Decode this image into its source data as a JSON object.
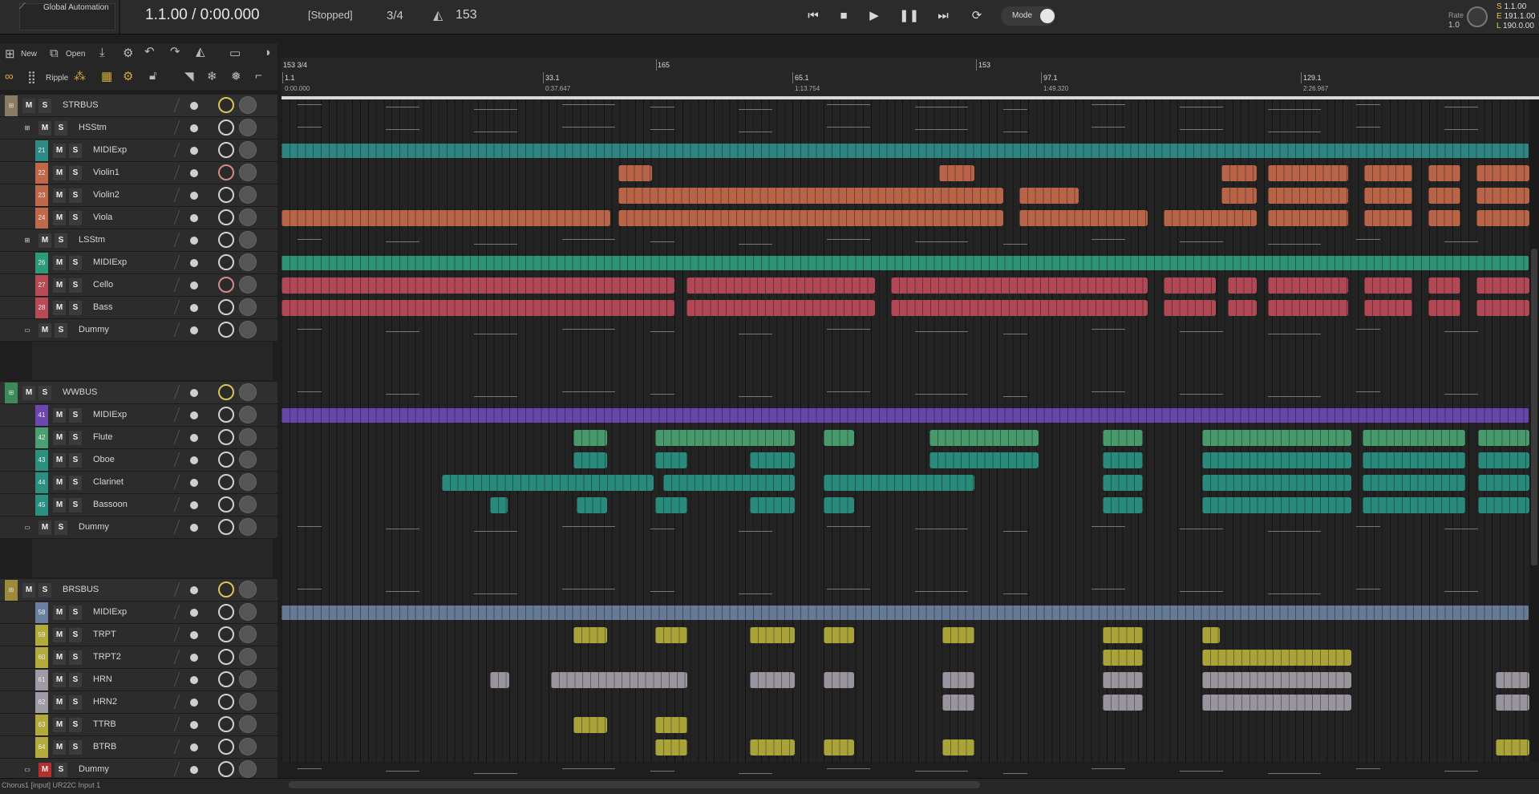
{
  "topbar": {
    "automation_label": "Global Automation",
    "position": "1.1.00 / 0:00.000",
    "state": "[Stopped]",
    "meter": "3/4",
    "tempo": "153",
    "mode_label": "Mode",
    "rate_label": "Rate",
    "rate_value": "1.0",
    "loop_start_label": "S",
    "loop_start": "1.1.00",
    "loop_end_label": "E",
    "loop_end": "191.1.00",
    "loop_length_label": "L",
    "loop_length": "190.0.00"
  },
  "toolbar": {
    "new_label": "New",
    "open_label": "Open",
    "ripple_label": "Ripple"
  },
  "ruler": {
    "marker_label": "153 3/4",
    "markers": [
      {
        "bar": "1.1",
        "time": "0:00.000"
      },
      {
        "bar": "33.1",
        "time": "0:37.647"
      },
      {
        "bar": "65.1",
        "time": "1:13.754"
      },
      {
        "bar": "97.1",
        "time": "1:49.320"
      },
      {
        "bar": "129.1",
        "time": "2:26.967"
      }
    ],
    "tempo_marks": [
      "165",
      "153"
    ]
  },
  "tracks": [
    {
      "id": "strbus",
      "num": "",
      "name": "STRBUS",
      "type": "bus",
      "color": "#8a7a64"
    },
    {
      "id": "hsstm",
      "num": "",
      "name": "HSStm",
      "type": "stem",
      "color": "#2c2c2c"
    },
    {
      "id": "t21",
      "num": "21",
      "name": "MIDIExp",
      "type": "track",
      "color": "#2f8a86"
    },
    {
      "id": "t22",
      "num": "22",
      "name": "Violin1",
      "type": "track",
      "color": "#c0684a"
    },
    {
      "id": "t23",
      "num": "23",
      "name": "Violin2",
      "type": "track",
      "color": "#c0684a"
    },
    {
      "id": "t24",
      "num": "24",
      "name": "Viola",
      "type": "track",
      "color": "#c0684a"
    },
    {
      "id": "lsstm",
      "num": "",
      "name": "LSStm",
      "type": "stem",
      "color": "#2c2c2c"
    },
    {
      "id": "t26",
      "num": "26",
      "name": "MIDIExp",
      "type": "track",
      "color": "#2f9a7a"
    },
    {
      "id": "t27",
      "num": "27",
      "name": "Cello",
      "type": "track",
      "color": "#b84a58"
    },
    {
      "id": "t28",
      "num": "28",
      "name": "Bass",
      "type": "track",
      "color": "#b84a58"
    },
    {
      "id": "dummy1",
      "num": "",
      "name": "Dummy",
      "type": "dummy",
      "color": "#2c2c2c"
    },
    {
      "id": "wwbus",
      "num": "",
      "name": "WWBUS",
      "type": "bus",
      "color": "#3c8a5a"
    },
    {
      "id": "t41",
      "num": "41",
      "name": "MIDIExp",
      "type": "track",
      "color": "#6a48b0"
    },
    {
      "id": "t42",
      "num": "42",
      "name": "Flute",
      "type": "track",
      "color": "#4aa070"
    },
    {
      "id": "t43",
      "num": "43",
      "name": "Oboe",
      "type": "track",
      "color": "#2a9080"
    },
    {
      "id": "t44",
      "num": "44",
      "name": "Clarinet",
      "type": "track",
      "color": "#2a9080"
    },
    {
      "id": "t45",
      "num": "45",
      "name": "Bassoon",
      "type": "track",
      "color": "#2a9080"
    },
    {
      "id": "dummy2",
      "num": "",
      "name": "Dummy",
      "type": "dummy",
      "color": "#2c2c2c"
    },
    {
      "id": "brsbus",
      "num": "",
      "name": "BRSBUS",
      "type": "bus",
      "color": "#9a8a3a"
    },
    {
      "id": "t58",
      "num": "58",
      "name": "MIDIExp",
      "type": "track",
      "color": "#6a7f9f"
    },
    {
      "id": "t59",
      "num": "59",
      "name": "TRPT",
      "type": "track",
      "color": "#b2aa3c"
    },
    {
      "id": "t60",
      "num": "60",
      "name": "TRPT2",
      "type": "track",
      "color": "#b2aa3c"
    },
    {
      "id": "t61",
      "num": "61",
      "name": "HRN",
      "type": "track",
      "color": "#a09aa4"
    },
    {
      "id": "t62",
      "num": "62",
      "name": "HRN2",
      "type": "track",
      "color": "#a09aa4"
    },
    {
      "id": "t63",
      "num": "63",
      "name": "TTRB",
      "type": "track",
      "color": "#b2aa3c"
    },
    {
      "id": "t64",
      "num": "64",
      "name": "BTRB",
      "type": "track",
      "color": "#b2aa3c"
    },
    {
      "id": "dummy3",
      "num": "",
      "name": "Dummy",
      "type": "dummy",
      "color": "#2c2c2c"
    }
  ],
  "buttons": {
    "mute": "M",
    "solo": "S"
  },
  "status": "Chorus1 [input] UR22C Input 1"
}
